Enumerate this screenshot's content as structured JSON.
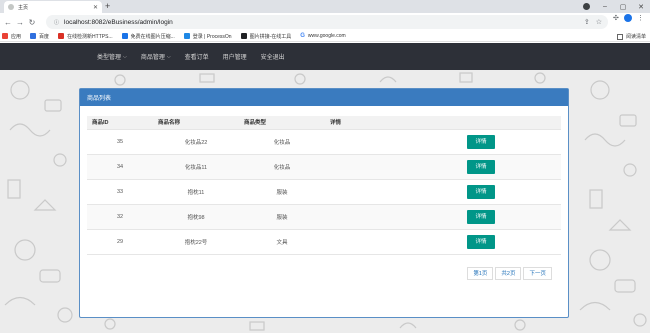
{
  "browser": {
    "tab_title": "主页",
    "new_tab_glyph": "+",
    "url_host": "localhost",
    "url_rest": ":8082/eBusiness/admin/login",
    "bookmarks": [
      {
        "label": "应用",
        "color": "#e94235"
      },
      {
        "label": "百度",
        "color": "#2f6fde"
      },
      {
        "label": "在线检测新HTTPS...",
        "color": "#d93025"
      },
      {
        "label": "免费在线图片压缩...",
        "color": "#1a73e8"
      },
      {
        "label": "登录 | ProcessOn",
        "color": "#1e88e5"
      },
      {
        "label": "图片拼接-在线工具",
        "color": "#202124"
      },
      {
        "label": "www.google.com",
        "color": "#4285f4"
      }
    ],
    "reading_list": "阅读清单"
  },
  "nav": {
    "items": [
      {
        "label": "类型管理",
        "dropdown": true
      },
      {
        "label": "商品管理",
        "dropdown": true
      },
      {
        "label": "查看订单",
        "dropdown": false
      },
      {
        "label": "用户管理",
        "dropdown": false
      },
      {
        "label": "安全退出",
        "dropdown": false
      }
    ]
  },
  "panel": {
    "title": "商品列表",
    "columns": [
      "商品ID",
      "商品名称",
      "商品类型",
      "详情"
    ],
    "rows": [
      {
        "id": "35",
        "name": "化妆品22",
        "type": "化妆品",
        "action": "详情"
      },
      {
        "id": "34",
        "name": "化妆品11",
        "type": "化妆品",
        "action": "详情"
      },
      {
        "id": "33",
        "name": "抱枕11",
        "type": "服装",
        "action": "详情"
      },
      {
        "id": "32",
        "name": "抱枕98",
        "type": "服装",
        "action": "详情"
      },
      {
        "id": "29",
        "name": "抱枕22号",
        "type": "文具",
        "action": "详情"
      }
    ],
    "pager": {
      "page": "第1页",
      "total": "共2页",
      "next": "下一页"
    }
  },
  "colors": {
    "nav_bg": "#2d3038",
    "panel_header": "#3a7bbf",
    "detail_button": "#009688"
  }
}
